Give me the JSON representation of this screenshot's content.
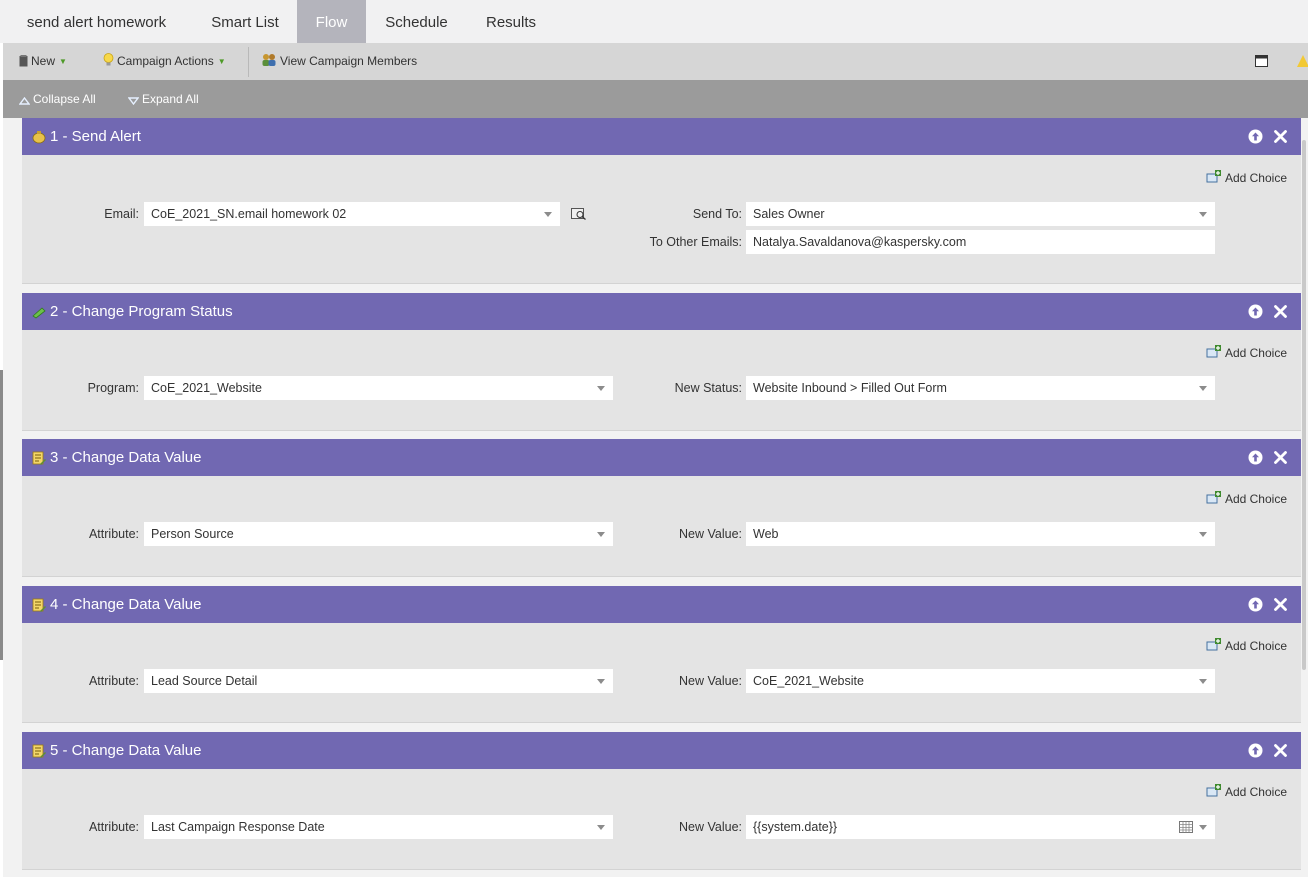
{
  "tabs": [
    {
      "label": "send alert homework",
      "active": false
    },
    {
      "label": "Smart List",
      "active": false
    },
    {
      "label": "Flow",
      "active": true
    },
    {
      "label": "Schedule",
      "active": false
    },
    {
      "label": "Results",
      "active": false
    }
  ],
  "toolbar": {
    "new_label": "New",
    "campaign_actions_label": "Campaign Actions",
    "view_members_label": "View Campaign Members"
  },
  "subbar": {
    "collapse_label": "Collapse All",
    "expand_label": "Expand All"
  },
  "colors": {
    "step_header": "#7168b2",
    "active_tab": "#b4b4bc",
    "toolbar": "#d6d6d6",
    "subbar": "#9b9b9b"
  },
  "steps": [
    {
      "title": "1 - Send Alert",
      "icon": "send-alert-icon",
      "add_choice": "Add Choice",
      "email_label": "Email:",
      "email_value": "CoE_2021_SN.email homework 02",
      "send_to_label": "Send To:",
      "send_to_value": "Sales Owner",
      "other_emails_label": "To Other Emails:",
      "other_emails_value": "Natalya.Savaldanova@kaspersky.com"
    },
    {
      "title": "2 - Change Program Status",
      "icon": "program-status-icon",
      "add_choice": "Add Choice",
      "left_label": "Program:",
      "left_value": "CoE_2021_Website",
      "right_label": "New Status:",
      "right_value": "Website Inbound > Filled Out Form"
    },
    {
      "title": "3 - Change Data Value",
      "icon": "data-value-icon",
      "add_choice": "Add Choice",
      "left_label": "Attribute:",
      "left_value": "Person Source",
      "right_label": "New Value:",
      "right_value": "Web"
    },
    {
      "title": "4 - Change Data Value",
      "icon": "data-value-icon",
      "add_choice": "Add Choice",
      "left_label": "Attribute:",
      "left_value": "Lead Source Detail",
      "right_label": "New Value:",
      "right_value": "CoE_2021_Website"
    },
    {
      "title": "5 - Change Data Value",
      "icon": "data-value-icon",
      "add_choice": "Add Choice",
      "left_label": "Attribute:",
      "left_value": "Last Campaign Response Date",
      "right_label": "New Value:",
      "right_value": "{{system.date}}"
    }
  ]
}
